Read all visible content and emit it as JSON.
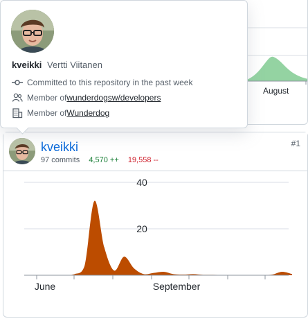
{
  "popover": {
    "login": "kveikki",
    "full_name": "Vertti Viitanen",
    "rows": [
      {
        "icon": "commit-icon",
        "text": "Committed to this repository in the past week",
        "link": ""
      },
      {
        "icon": "people-icon",
        "text": "Member of ",
        "link": "wunderdogsw/developers"
      },
      {
        "icon": "organization-icon",
        "text": "Member of ",
        "link": "Wunderdog"
      }
    ]
  },
  "background_card": {
    "x_tick": "August"
  },
  "contributor": {
    "login": "kveikki",
    "commits": "97 commits",
    "additions": "4,570 ++",
    "deletions": "19,558 --",
    "rank": "#1"
  },
  "colors": {
    "area_fill": "#bc4c00",
    "bg_area_fill": "#94d3a2",
    "link": "#0969da"
  },
  "chart_data": {
    "type": "area",
    "x_tick_labels": [
      "June",
      "September"
    ],
    "y_tick_labels": [
      "40",
      "20"
    ],
    "ylim": [
      0,
      40
    ],
    "weeks": [
      0,
      1,
      2,
      3,
      4,
      5,
      6,
      7,
      8,
      9,
      10,
      11,
      12,
      13,
      14,
      15,
      16,
      17,
      18,
      19,
      20,
      21,
      22,
      23,
      24,
      25
    ],
    "values": [
      0,
      0,
      0,
      0.5,
      4,
      32,
      12,
      2,
      8,
      3,
      0.5,
      1,
      1.5,
      0.5,
      0.3,
      0.5,
      0.2,
      0.2,
      0.1,
      0.1,
      0.1,
      0.1,
      0.1,
      0.3,
      1.5,
      0.5
    ],
    "grid": true
  }
}
